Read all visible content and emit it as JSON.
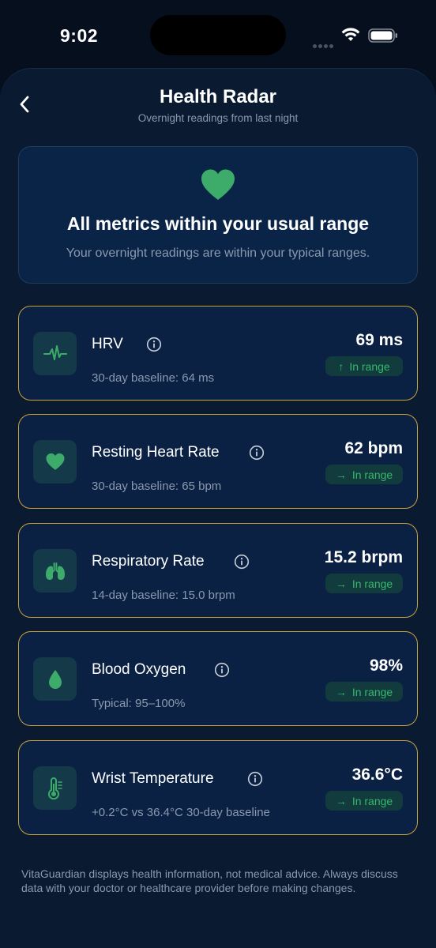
{
  "status_bar": {
    "time": "9:02"
  },
  "header": {
    "title": "Health Radar",
    "subtitle": "Overnight readings from last night"
  },
  "summary": {
    "title": "All metrics within your usual range",
    "text": "Your overnight readings are within your typical ranges.",
    "icon": "heart-icon"
  },
  "metrics": [
    {
      "name": "HRV",
      "baseline": "30-day baseline: 64 ms",
      "value": "69 ms",
      "status": "In range",
      "trend_arrow": "↑",
      "icon": "pulse-icon"
    },
    {
      "name": "Resting Heart Rate",
      "baseline": "30-day baseline: 65 bpm",
      "value": "62 bpm",
      "status": "In range",
      "trend_arrow": "→",
      "icon": "heart-icon"
    },
    {
      "name": "Respiratory Rate",
      "baseline": "14-day baseline: 15.0 brpm",
      "value": "15.2 brpm",
      "status": "In range",
      "trend_arrow": "→",
      "icon": "lungs-icon"
    },
    {
      "name": "Blood Oxygen",
      "baseline": "Typical: 95–100%",
      "value": "98%",
      "status": "In range",
      "trend_arrow": "→",
      "icon": "droplet-icon"
    },
    {
      "name": "Wrist Temperature",
      "baseline": "+0.2°C vs 36.4°C 30-day baseline",
      "value": "36.6°C",
      "status": "In range",
      "trend_arrow": "→",
      "icon": "thermometer-icon"
    }
  ],
  "disclaimer": "VitaGuardian displays health information, not medical advice. Always discuss data with your doctor or healthcare provider before making changes.",
  "colors": {
    "background": "#060f1e",
    "accent_green": "#3dab69",
    "card_border": "#c9a23a",
    "card_background": "#0a2144"
  }
}
